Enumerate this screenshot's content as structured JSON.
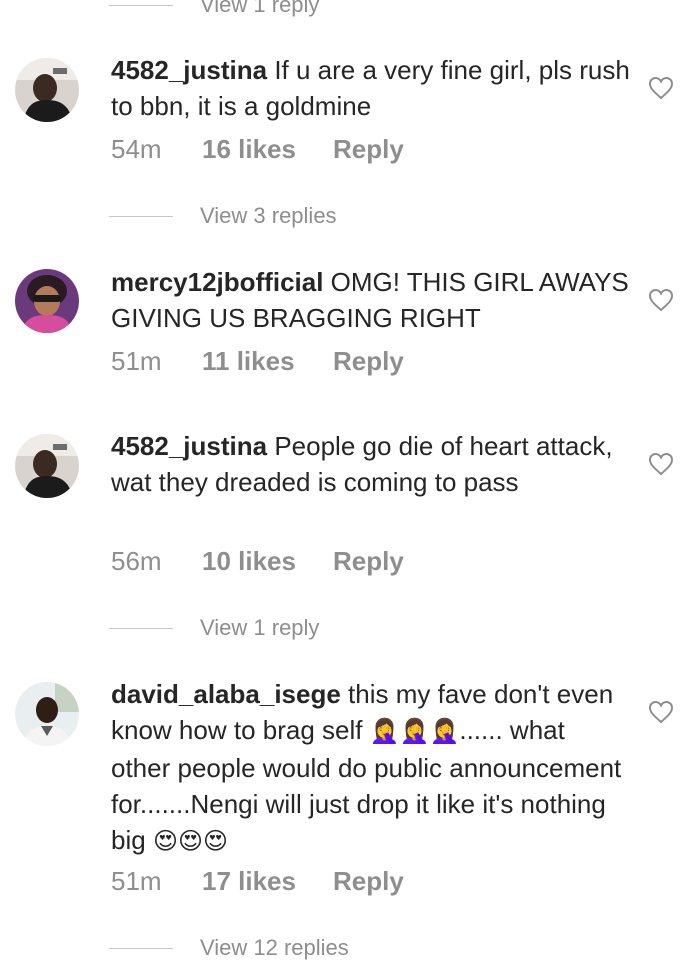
{
  "comments": [
    {
      "username": "4582_justina",
      "text": "If u are a very fine girl, pls rush to bbn, it is a goldmine",
      "time": "54m",
      "likes": "16 likes",
      "reply_label": "Reply",
      "view_replies": "View 3 replies"
    },
    {
      "username": "mercy12jbofficial",
      "text": "OMG! THIS GIRL AWAYS GIVING US BRAGGING RIGHT",
      "time": "51m",
      "likes": "11 likes",
      "reply_label": "Reply"
    },
    {
      "username": "4582_justina",
      "text": "People go die of heart attack, wat they dreaded  is coming to pass",
      "time": "56m",
      "likes": "10 likes",
      "reply_label": "Reply",
      "view_replies": "View 1 reply"
    },
    {
      "username": "david_alaba_isege",
      "text_part1": "this my fave don't even know how to brag self",
      "emoji1": "🤦‍♀️🤦‍♀️🤦‍♀️",
      "text_part2": "...... what other people would do  public announcement for.......Nengi will just drop it like it's nothing big",
      "emoji2": "😍😍😍",
      "time": "51m",
      "likes": "17 likes",
      "reply_label": "Reply",
      "view_replies": "View 12 replies"
    }
  ],
  "top_view_replies": "View 1 reply"
}
